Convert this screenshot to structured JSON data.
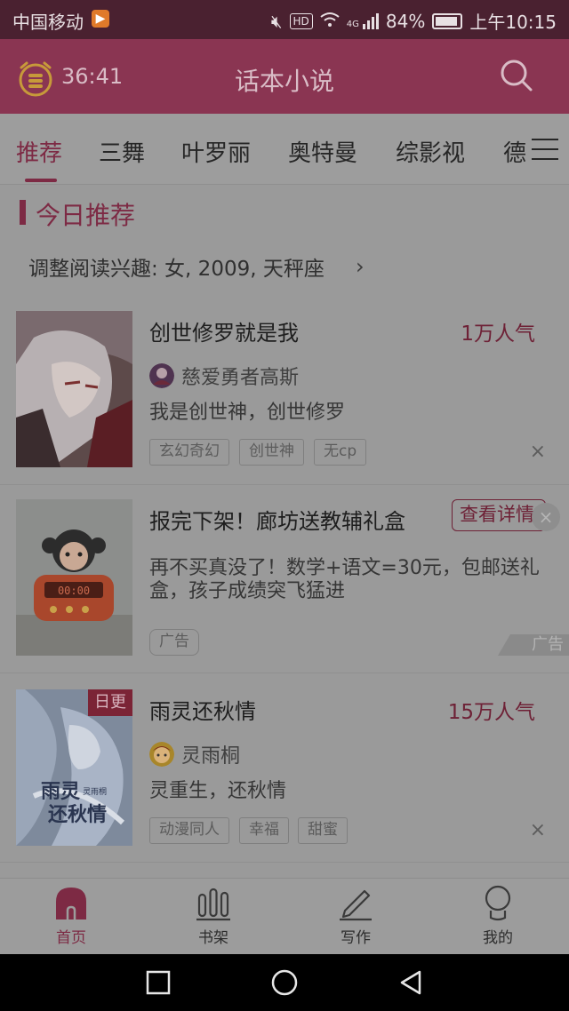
{
  "status_bar": {
    "carrier": "中国移动",
    "app_badge_icon": "play-badge-icon",
    "network": "4G",
    "hd": "HD",
    "battery": "84%",
    "time": "上午10:15"
  },
  "header": {
    "timer": "36:41",
    "title": "话本小说",
    "search_icon": "search-icon"
  },
  "tabs": [
    "推荐",
    "三舞",
    "叶罗丽",
    "奥特曼",
    "综影视",
    "德"
  ],
  "active_tab": 0,
  "section": {
    "title": "今日推荐",
    "interest": "调整阅读兴趣: 女, 2009, 天秤座",
    "chevron": "›"
  },
  "books": [
    {
      "title": "创世修罗就是我",
      "popularity": "1万人气",
      "author": "慈爱勇者高斯",
      "description": "我是创世神，创世修罗",
      "tags": [
        "玄幻奇幻",
        "创世神",
        "无cp"
      ]
    },
    {
      "title": "雨灵还秋情",
      "popularity": "15万人气",
      "author": "灵雨桐",
      "description": "灵重生，还秋情",
      "tags": [
        "动漫同人",
        "幸福",
        "甜蜜"
      ],
      "badge": "日更",
      "cover_text_1": "雨灵",
      "cover_text_2": "还秋情",
      "cover_small": "灵雨桐"
    }
  ],
  "ad": {
    "title": "报完下架！廊坊送教辅礼盒",
    "button": "查看详情",
    "description_line1": "再不买真没了！数学+语文=30元，包邮送礼",
    "description_line2": "盒，孩子成绩突飞猛进",
    "tag": "广告",
    "corner": "广告",
    "clock_display": "00:00"
  },
  "close_glyph": "×",
  "bottom_nav": [
    {
      "label": "首页",
      "icon": "home-icon"
    },
    {
      "label": "书架",
      "icon": "bookshelf-icon"
    },
    {
      "label": "写作",
      "icon": "pen-icon"
    },
    {
      "label": "我的",
      "icon": "profile-icon"
    }
  ],
  "colors": {
    "accent": "#7d2a44",
    "header_bg": "#8a3552",
    "status_bg": "#4a2130",
    "overlay_bg": "#9a9a9a"
  }
}
